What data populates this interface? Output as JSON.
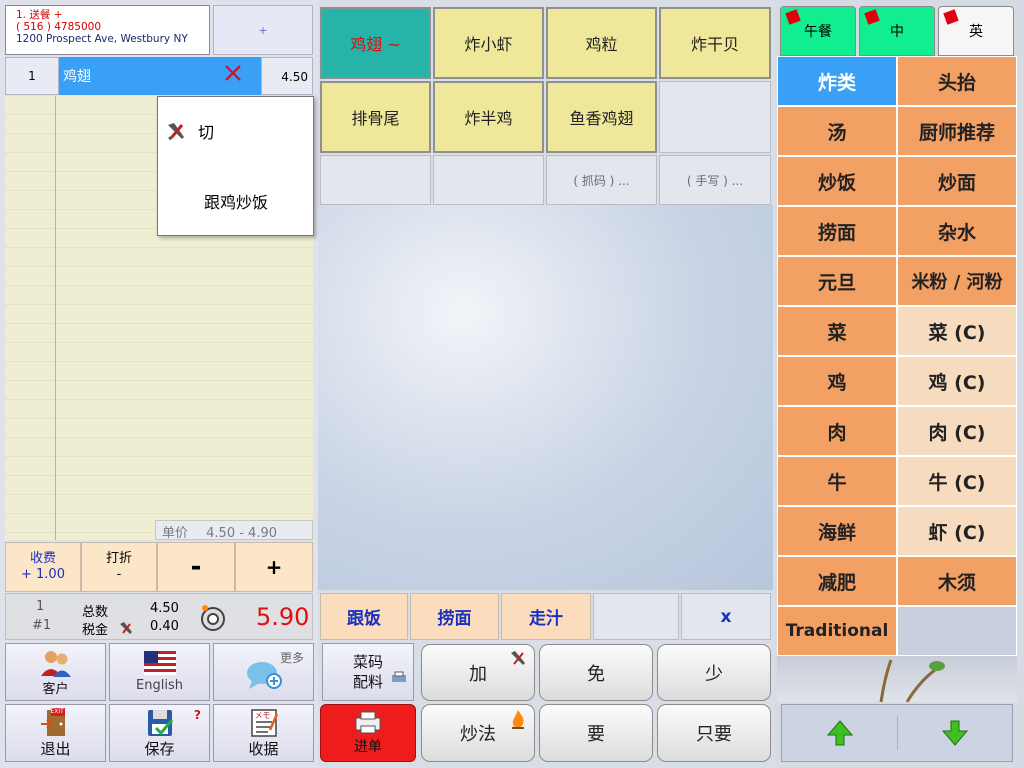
{
  "order_info": {
    "line1": "1. 送餐 +",
    "line2": "( 516 ) 4785000",
    "line3": "1200 Prospect Ave, Westbury NY"
  },
  "top_plus": "+",
  "order_line": {
    "qty": "1",
    "name": "鸡翅",
    "price": "4.50"
  },
  "popup": {
    "item1": "切",
    "item2": "跟鸡炒饭"
  },
  "unit_price": {
    "label": "单价",
    "range": "4.50  -  4.90"
  },
  "charge": {
    "label": "收费",
    "value": "+ 1.00"
  },
  "discount": {
    "label": "打折",
    "value": "-"
  },
  "minus": "-",
  "plus": "+",
  "totals": {
    "count": "1",
    "order_no": "#1",
    "subtotal_label": "总数",
    "tax_label": "税金",
    "subtotal": "4.50",
    "tax": "0.40",
    "grand_total": "5.90"
  },
  "bottom_left": {
    "customer": "客户",
    "english": "English",
    "more": "更多",
    "exit": "退出",
    "exit_sign": "EXIT",
    "save": "保存",
    "save_badge": "?",
    "receipt": "收据",
    "memo": "メモ"
  },
  "items": [
    "鸡翅 ~",
    "炸小虾",
    "鸡粒",
    "炸干贝",
    "排骨尾",
    "炸半鸡",
    "鱼香鸡翅"
  ],
  "grab_code": "( 抓码 ) ...",
  "handwrite": "( 手写 ) ...",
  "modifiers": {
    "m1": "跟饭",
    "m2": "捞面",
    "m3": "走汁",
    "x": "x"
  },
  "actions": {
    "recipe": "菜码\n配料",
    "add": "加",
    "free": "免",
    "less": "少",
    "send": "进单",
    "cook": "炒法",
    "want": "要",
    "only": "只要"
  },
  "tabs": {
    "lunch": "午餐",
    "chinese": "中",
    "english": "英"
  },
  "categories": [
    "炸类",
    "头抬",
    "汤",
    "厨师推荐",
    "炒饭",
    "炒面",
    "捞面",
    "杂水",
    "元旦",
    "米粉 / 河粉",
    "菜",
    "菜 (C)",
    "鸡",
    "鸡 (C)",
    "肉",
    "肉 (C)",
    "牛",
    "牛 (C)",
    "海鲜",
    "虾 (C)",
    "减肥",
    "木须",
    "Traditional",
    ""
  ],
  "colors": {
    "selected_item": "#26b3a9",
    "item_yellow": "#efe89a",
    "category_orange": "#f3a064",
    "category_light": "#f6dbbf",
    "category_selected": "#3aa0f5",
    "send_red": "#ee1c1c",
    "total_red": "#e01010",
    "tab_green": "#10ee90"
  }
}
